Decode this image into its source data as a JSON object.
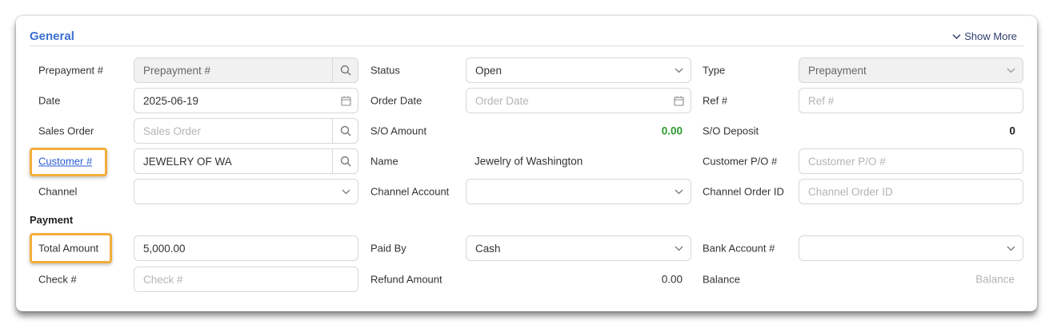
{
  "section": {
    "title": "General",
    "show_more": "Show More",
    "payment_title": "Payment"
  },
  "fields": {
    "prepayment_no": {
      "label": "Prepayment #",
      "placeholder": "Prepayment #"
    },
    "status": {
      "label": "Status",
      "value": "Open"
    },
    "type": {
      "label": "Type",
      "value": "Prepayment"
    },
    "date": {
      "label": "Date",
      "value": "2025-06-19"
    },
    "order_date": {
      "label": "Order Date",
      "placeholder": "Order Date"
    },
    "ref_no": {
      "label": "Ref #",
      "placeholder": "Ref #"
    },
    "sales_order": {
      "label": "Sales Order",
      "placeholder": "Sales Order"
    },
    "so_amount": {
      "label": "S/O Amount",
      "value": "0.00"
    },
    "so_deposit": {
      "label": "S/O Deposit",
      "value": "0"
    },
    "customer_no": {
      "label": "Customer #",
      "value": "JEWELRY OF WA"
    },
    "name": {
      "label": "Name",
      "value": "Jewelry of Washington"
    },
    "customer_po": {
      "label": "Customer P/O #",
      "placeholder": "Customer P/O #"
    },
    "channel": {
      "label": "Channel",
      "value": ""
    },
    "channel_account": {
      "label": "Channel Account",
      "value": ""
    },
    "channel_order_id": {
      "label": "Channel Order ID",
      "placeholder": "Channel Order ID"
    },
    "total_amount": {
      "label": "Total Amount",
      "value": "5,000.00"
    },
    "paid_by": {
      "label": "Paid By",
      "value": "Cash"
    },
    "bank_account": {
      "label": "Bank Account #",
      "value": ""
    },
    "check_no": {
      "label": "Check #",
      "placeholder": "Check #"
    },
    "refund_amount": {
      "label": "Refund Amount",
      "value": "0.00"
    },
    "balance": {
      "label": "Balance",
      "placeholder": "Balance"
    }
  },
  "colors": {
    "accent": "#3b6fd1",
    "highlight": "#f3ae3b",
    "positive": "#2e9a2e",
    "link": "#2a5bd7"
  },
  "icons": {
    "search": "search-icon",
    "calendar": "calendar-icon",
    "dropdown": "chevron-down-icon"
  }
}
